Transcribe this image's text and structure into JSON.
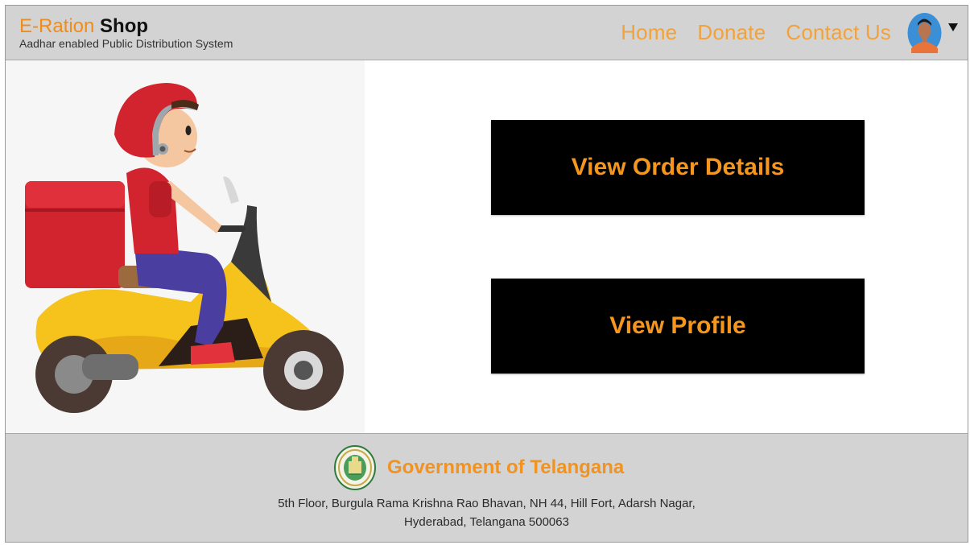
{
  "header": {
    "brand_part1": "E-Ration",
    "brand_part2": "Shop",
    "tagline": "Aadhar enabled Public Distribution System",
    "nav": [
      "Home",
      "Donate",
      "Contact Us"
    ],
    "brand_color": "#ef8c1a",
    "nav_color": "#f2a23a"
  },
  "main": {
    "buttons": [
      "View Order Details",
      "View Profile"
    ],
    "button_bg": "#000000",
    "button_text_color": "#f5961e"
  },
  "footer": {
    "title": "Government of Telangana",
    "address_line1": "5th Floor, Burgula Rama Krishna Rao Bhavan, NH 44, Hill Fort, Adarsh Nagar,",
    "address_line2": "Hyderabad, Telangana 500063",
    "emblem_icon": "telangana-emblem-icon"
  },
  "icons": {
    "avatar": "user-avatar-icon",
    "caret": "caret-down-icon",
    "illustration": "delivery-scooter-illustration"
  }
}
